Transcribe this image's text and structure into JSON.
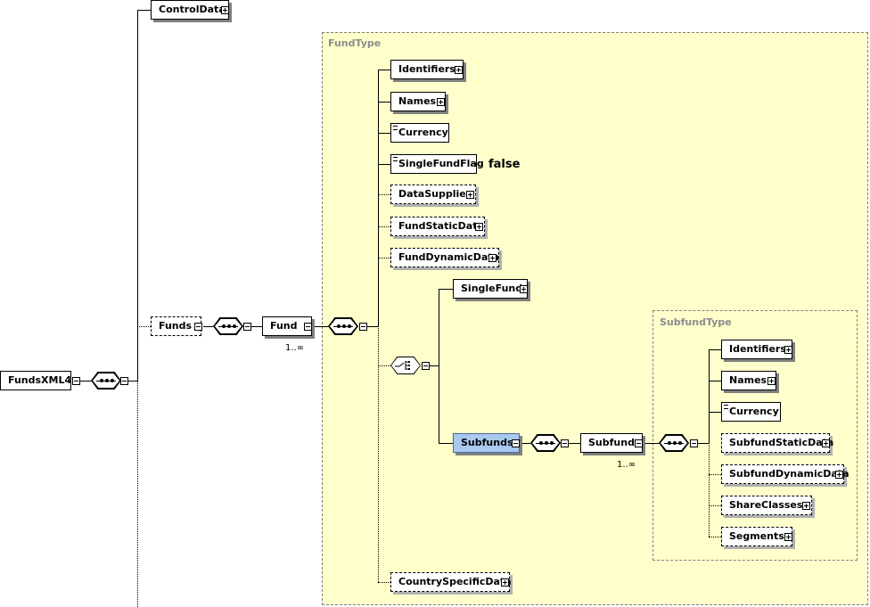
{
  "fund_type_label": "FundType",
  "subfund_type_label": "SubfundType",
  "root": {
    "label": "FundsXML4"
  },
  "control_data": {
    "label": "ControlData"
  },
  "funds": {
    "label": "Funds"
  },
  "fund": {
    "label": "Fund",
    "cardinality": "1..∞"
  },
  "fund_children": {
    "identifiers": "Identifiers",
    "names": "Names",
    "currency": "Currency",
    "single_fund_flag": "SingleFundFlag",
    "single_fund_flag_value": "false",
    "data_supplier": "DataSupplier",
    "fund_static_data": "FundStaticData",
    "fund_dynamic_data": "FundDynamicData",
    "single_fund": "SingleFund",
    "subfunds": "Subfunds",
    "country_specific_data": "CountrySpecificData"
  },
  "subfund": {
    "label": "Subfund",
    "cardinality": "1..∞"
  },
  "subfund_children": {
    "identifiers": "Identifiers",
    "names": "Names",
    "currency": "Currency",
    "subfund_static_data": "SubfundStaticData",
    "subfund_dynamic_data": "SubfundDynamicData",
    "share_classes": "ShareClasses",
    "segments": "Segments"
  },
  "colors": {
    "group_fill": "#ffffcc",
    "highlight": "#a9c9ef"
  }
}
